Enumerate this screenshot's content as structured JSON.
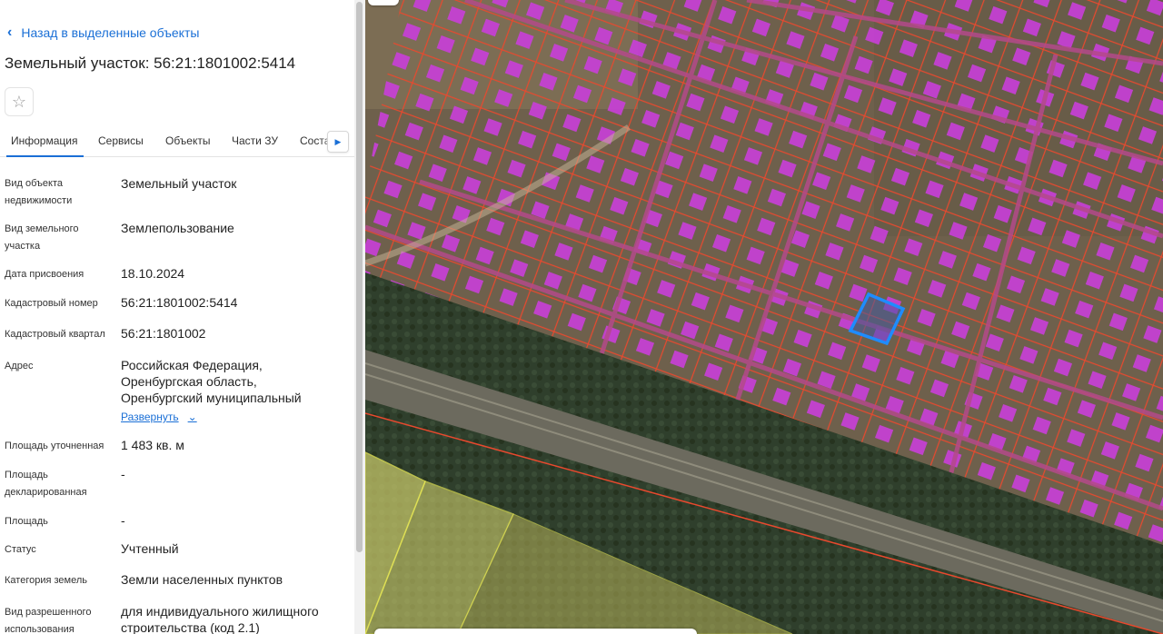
{
  "nav": {
    "back_label": "Назад в выделенные объекты"
  },
  "object": {
    "title": "Земельный участок: 56:21:1801002:5414"
  },
  "tabs": [
    {
      "label": "Информация",
      "active": true
    },
    {
      "label": "Сервисы",
      "active": false
    },
    {
      "label": "Объекты",
      "active": false
    },
    {
      "label": "Части ЗУ",
      "active": false
    },
    {
      "label": "Соста",
      "active": false
    }
  ],
  "props": [
    {
      "label": "Вид объекта недвижимости",
      "value": "Земельный участок"
    },
    {
      "label": "Вид земельного участка",
      "value": "Землепользование"
    },
    {
      "label": "Дата присвоения",
      "value": "18.10.2024"
    },
    {
      "label": "Кадастровый номер",
      "value": "56:21:1801002:5414"
    },
    {
      "label": "Кадастровый квартал",
      "value": "56:21:1801002"
    },
    {
      "label": "Адрес",
      "value": "Российская Федерация, Оренбургская область, Оренбургский муниципальный"
    },
    {
      "label": "Площадь уточненная",
      "value": "1 483 кв. м"
    },
    {
      "label": "Площадь декларированная",
      "value": "-"
    },
    {
      "label": "Площадь",
      "value": "-"
    },
    {
      "label": "Статус",
      "value": "Учтенный"
    },
    {
      "label": "Категория земель",
      "value": "Земли населенных пунктов"
    },
    {
      "label": "Вид разрешенного использования",
      "value": "для индивидуального жилищного строительства (код 2.1)"
    }
  ],
  "address_expand_label": "Развернуть",
  "icons": {
    "back": "chevron-left-icon",
    "favorite": "star-icon",
    "tabs_scroll": "chevron-right-icon",
    "expand": "chevron-down-icon"
  },
  "colors": {
    "accent": "#1a6fd6",
    "parcel_border": "#e8492e",
    "building_fill": "#c73fd6",
    "selected_parcel": "#1e8cff",
    "zone_fill": "#c8c86a"
  }
}
